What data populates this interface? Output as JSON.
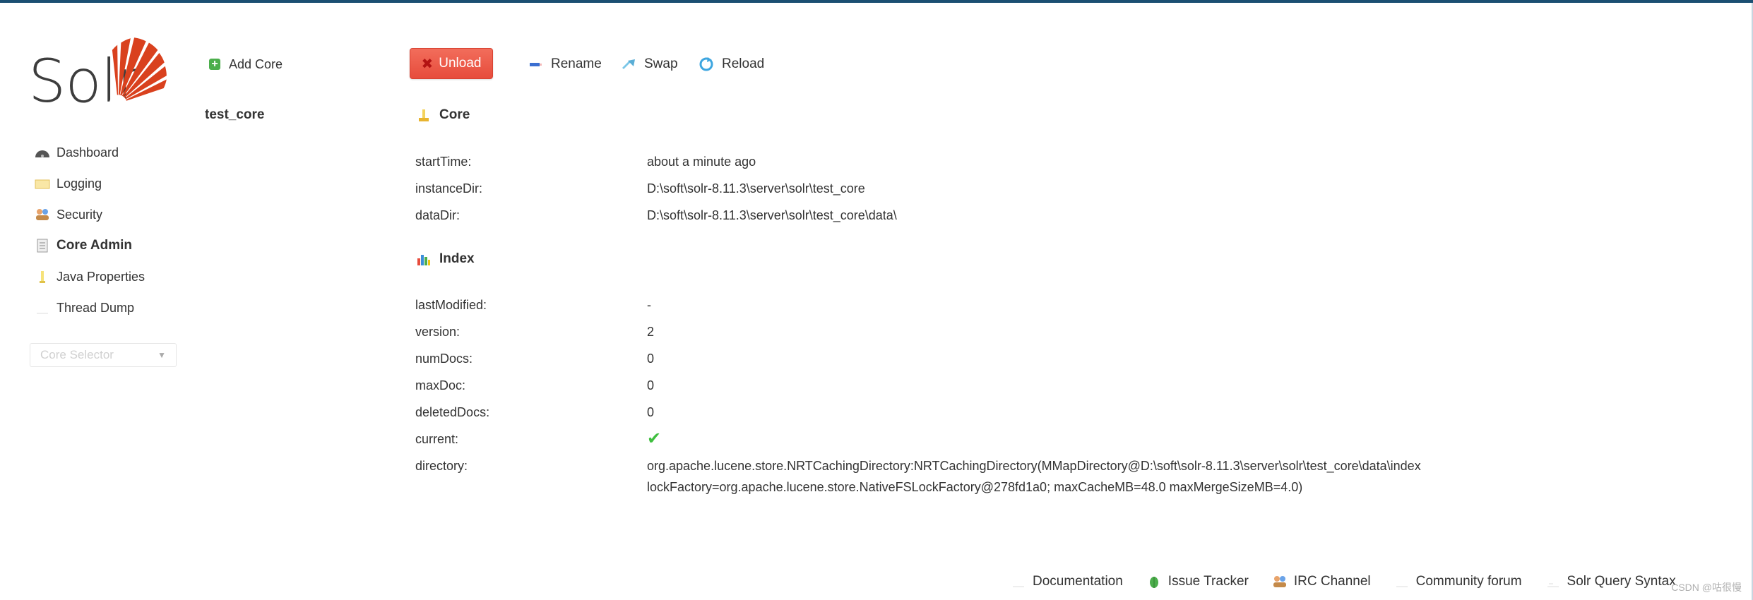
{
  "app": {
    "logo_text": "Solr",
    "brand_color": "#d9411e"
  },
  "nav": {
    "items": [
      {
        "label": "Dashboard",
        "icon": "dashboard-icon"
      },
      {
        "label": "Logging",
        "icon": "logging-icon"
      },
      {
        "label": "Security",
        "icon": "security-icon"
      },
      {
        "label": "Core Admin",
        "icon": "core-admin-icon",
        "active": true
      },
      {
        "label": "Java Properties",
        "icon": "java-properties-icon"
      },
      {
        "label": "Thread Dump",
        "icon": "thread-dump-icon"
      }
    ],
    "core_selector_placeholder": "Core Selector"
  },
  "cores": {
    "add_label": "Add Core",
    "list": [
      "test_core"
    ]
  },
  "toolbar": {
    "unload": "Unload",
    "rename": "Rename",
    "swap": "Swap",
    "reload": "Reload"
  },
  "core_section": {
    "title": "Core",
    "rows": [
      {
        "key": "startTime:",
        "value": "about a minute ago"
      },
      {
        "key": "instanceDir:",
        "value": "D:\\soft\\solr-8.11.3\\server\\solr\\test_core"
      },
      {
        "key": "dataDir:",
        "value": "D:\\soft\\solr-8.11.3\\server\\solr\\test_core\\data\\"
      }
    ]
  },
  "index_section": {
    "title": "Index",
    "rows": [
      {
        "key": "lastModified:",
        "value": "-"
      },
      {
        "key": "version:",
        "value": "2"
      },
      {
        "key": "numDocs:",
        "value": "0"
      },
      {
        "key": "maxDoc:",
        "value": "0"
      },
      {
        "key": "deletedDocs:",
        "value": "0"
      },
      {
        "key": "current:",
        "value": "✔"
      },
      {
        "key": "directory:",
        "value": "org.apache.lucene.store.NRTCachingDirectory:NRTCachingDirectory(MMapDirectory@D:\\soft\\solr-8.11.3\\server\\solr\\test_core\\data\\index lockFactory=org.apache.lucene.store.NativeFSLockFactory@278fd1a0; maxCacheMB=48.0 maxMergeSizeMB=4.0)"
      }
    ]
  },
  "footer": {
    "links": [
      {
        "label": "Documentation",
        "icon": "documentation-icon"
      },
      {
        "label": "Issue Tracker",
        "icon": "bug-icon"
      },
      {
        "label": "IRC Channel",
        "icon": "irc-icon"
      },
      {
        "label": "Community forum",
        "icon": "forum-icon"
      },
      {
        "label": "Solr Query Syntax",
        "icon": "query-syntax-icon"
      }
    ],
    "watermark": "CSDN @咕很慢"
  }
}
